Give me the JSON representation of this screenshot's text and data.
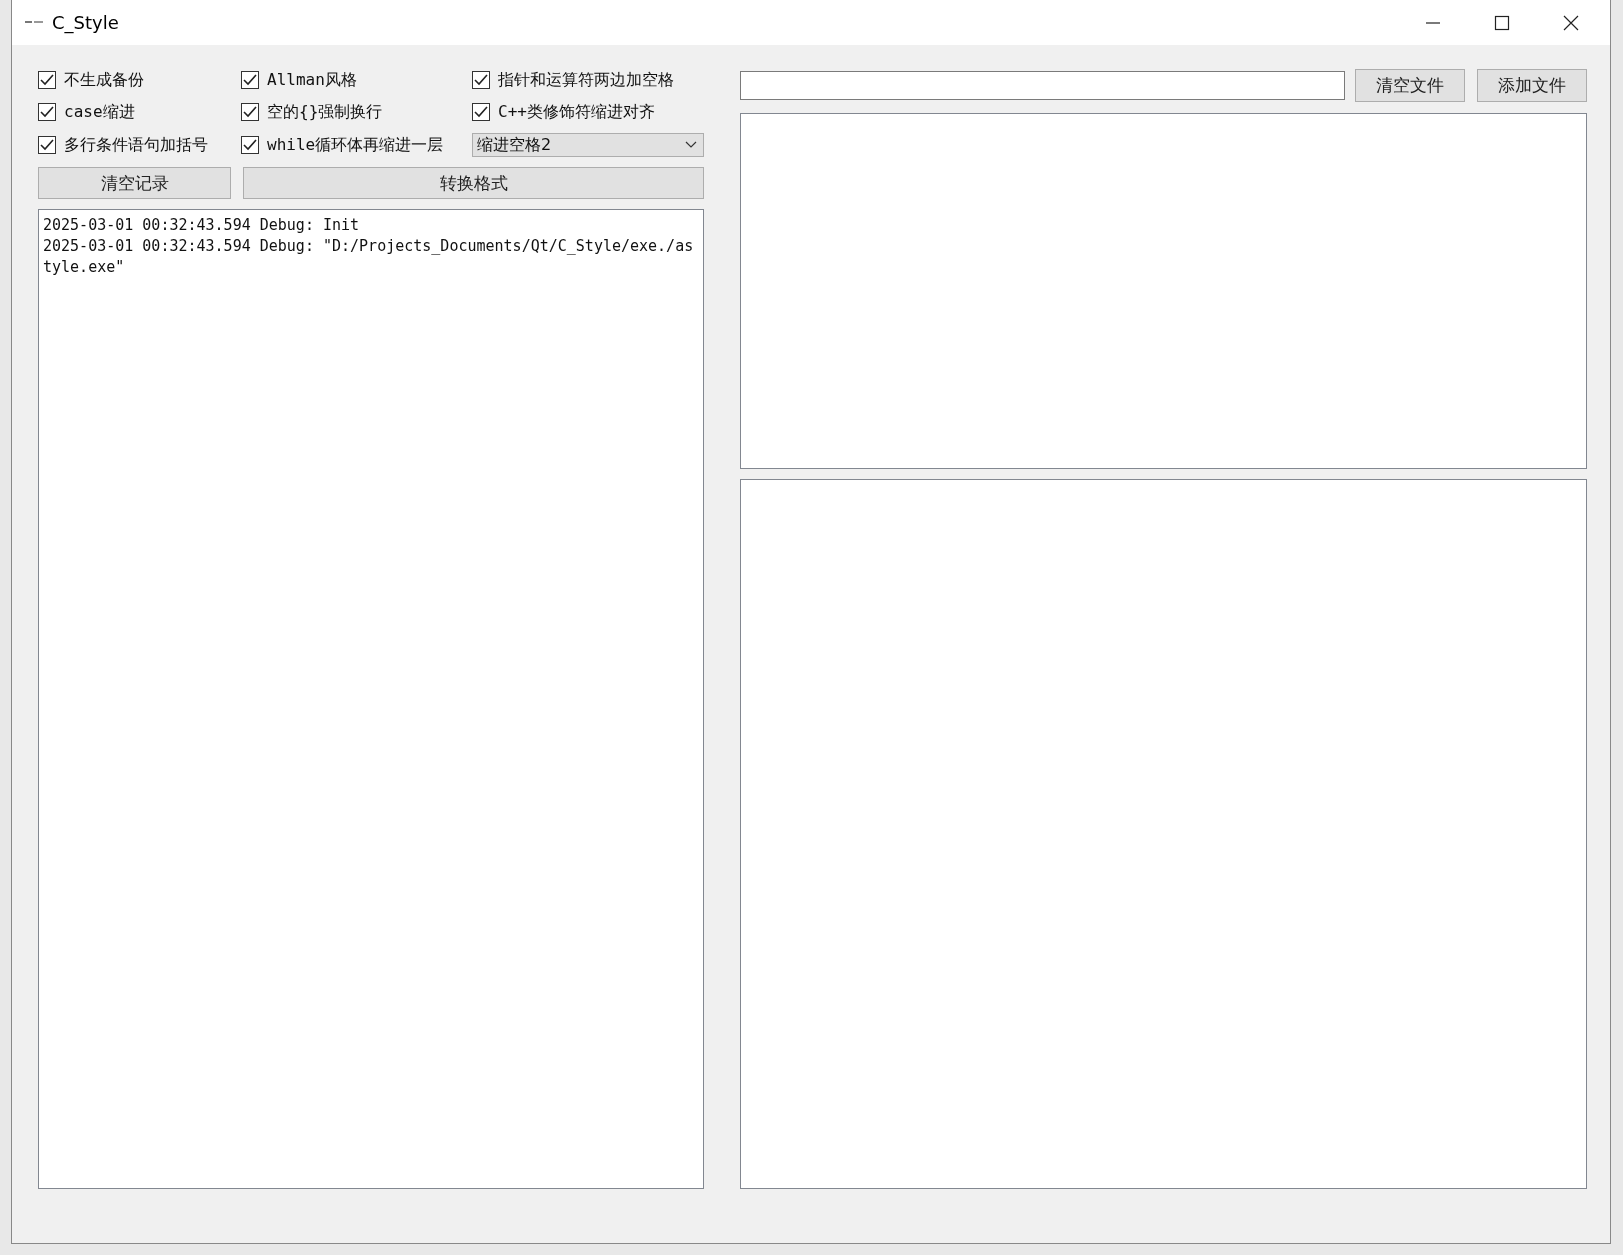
{
  "window": {
    "title": "C_Style"
  },
  "options": [
    {
      "label": "不生成备份",
      "checked": true
    },
    {
      "label": "Allman风格",
      "checked": true
    },
    {
      "label": "指针和运算符两边加空格",
      "checked": true
    },
    {
      "label": "case缩进",
      "checked": true
    },
    {
      "label": "空的{}强制换行",
      "checked": true
    },
    {
      "label": "C++类修饰符缩进对齐",
      "checked": true
    },
    {
      "label": "多行条件语句加括号",
      "checked": true
    },
    {
      "label": "while循环体再缩进一层",
      "checked": true
    }
  ],
  "indent_dropdown": {
    "value": "缩进空格2"
  },
  "left_buttons": [
    "清空记录",
    "转换格式"
  ],
  "log": [
    "2025-03-01 00:32:43.594 Debug: Init",
    "2025-03-01 00:32:43.594 Debug: \"D:/Projects_Documents/Qt/C_Style/exe./astyle.exe\""
  ],
  "file_buttons": [
    "清空文件",
    "添加文件"
  ]
}
